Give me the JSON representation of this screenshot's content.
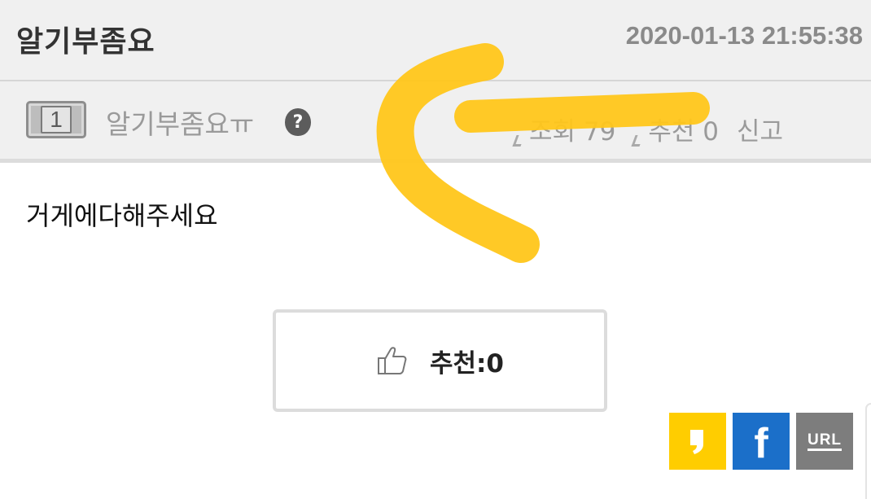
{
  "post": {
    "title": "알기부좀요",
    "date": "2020-01-13 21:55:38",
    "body": "거게에다해주세요"
  },
  "author": {
    "level": "1",
    "name": "알기부좀요ㅠ",
    "help_icon": "question-icon"
  },
  "meta": {
    "views": "조회 79",
    "recommends": "추천 0",
    "report": "신고"
  },
  "recommend_button": {
    "label": "추천:0",
    "icon": "thumbs-up-icon"
  },
  "share": {
    "kakao_icon": "kakaostory-icon",
    "facebook_label": "f",
    "url_label": "URL"
  },
  "colors": {
    "header_bg": "#f0f0f0",
    "annotation": "#ffc61a",
    "kakao": "#ffcd00",
    "facebook": "#1b6fc9",
    "url": "#7d7d7d"
  }
}
